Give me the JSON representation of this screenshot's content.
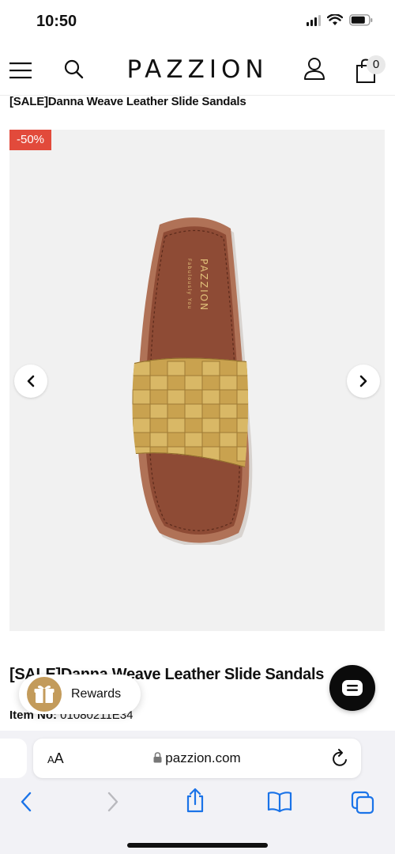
{
  "status_bar": {
    "time": "10:50"
  },
  "header": {
    "logo": "PAZZION",
    "cart_count": "0"
  },
  "breadcrumb_title": "[SALE]Danna Weave Leather Slide Sandals",
  "gallery": {
    "badge": "-50%",
    "insole_brand": "PAZZION",
    "insole_tagline": "Fabulously You"
  },
  "product": {
    "name": "[SALE]Danna Weave Leather Slide Sandals",
    "item_no_label": "Item No:",
    "item_no_value": "01080211E34"
  },
  "rewards": {
    "label": "Rewards"
  },
  "browser": {
    "aa_small": "A",
    "aa_large": "A",
    "url": "pazzion.com"
  },
  "colors": {
    "accent": "#e24a3b",
    "rewards_gold": "#c39b5b",
    "ios_blue": "#1a73e8"
  }
}
